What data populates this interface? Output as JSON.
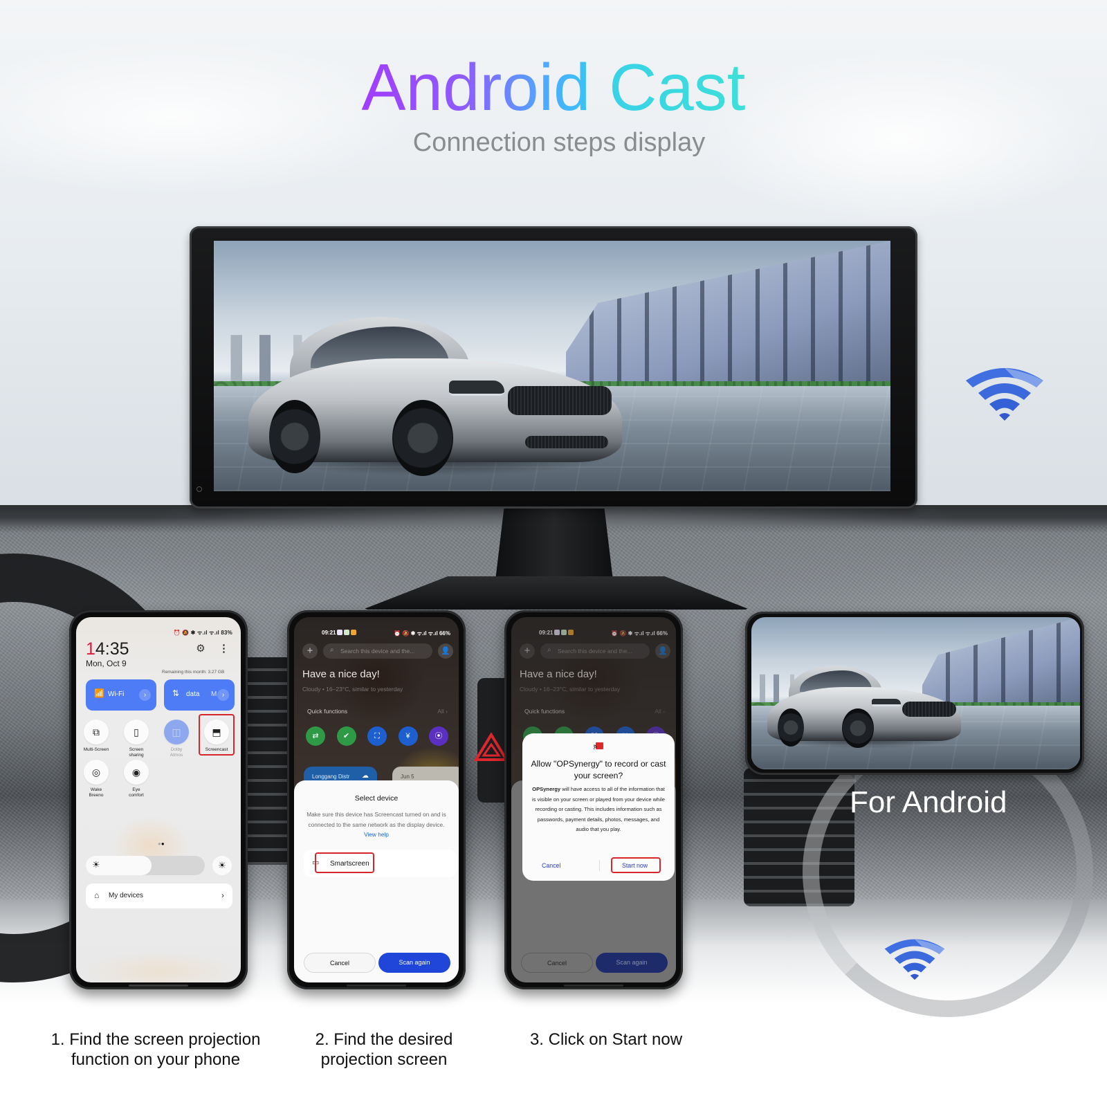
{
  "header": {
    "title_part1": "Android",
    "title_part2": "Cast",
    "subtitle": "Connection steps display"
  },
  "colors": {
    "title_gradient_start": "#a23cff",
    "title_gradient_mid": "#4fa9ff",
    "title_end": "#3edfd9",
    "tile_blue": "#4e7cf6",
    "highlight_red": "#d7262b",
    "scan_button_blue": "#1f45d9",
    "wifi_blue": "#3f6fe0"
  },
  "phone_android": {
    "label": "For Android"
  },
  "step1_phone": {
    "status_right": "⏰ 🔕 ✱ ᯤ.ıl ᯤ.ıl 83%",
    "time_first_digit": "1",
    "time_rest": "4:35",
    "date": "Mon, Oct 9",
    "remaining": "Remaining this month: 3.27 GB",
    "tiles": [
      {
        "icon": "wifi-icon",
        "label": "Wi-Fi"
      },
      {
        "icon": "data-icon",
        "label": "data",
        "extra": "M"
      }
    ],
    "quick_settings": [
      {
        "label": "Multi-Screen",
        "icon": "multi-screen-icon",
        "glyph": "⧉"
      },
      {
        "label": "Screen\nsharing",
        "icon": "screen-sharing-icon",
        "glyph": "▯"
      },
      {
        "label": "Dolby\nAtmos",
        "icon": "dolby-icon",
        "glyph": "◫"
      },
      {
        "label": "Screencast",
        "icon": "screencast-icon",
        "glyph": "⬒"
      },
      {
        "label": "Wake\nBreeno",
        "icon": "breeno-icon",
        "glyph": "◎"
      },
      {
        "label": "Eye\ncomfort",
        "icon": "eye-icon",
        "glyph": "◉"
      }
    ],
    "brightness_fraction": 0.55,
    "my_devices_label": "My devices"
  },
  "launcher": {
    "status_time": "09:21",
    "status_right": "⏰ 🔕 ✱ ᯤ.ıl ᯤ.ıl 66%",
    "search_placeholder": "Search this device and the...",
    "greeting": "Have a nice day!",
    "weather": "Cloudy • 16–23°C, similar to yesterday",
    "quick_functions_label": "Quick functions",
    "all_label": "All",
    "apps": [
      {
        "icon": "app-transfer-icon",
        "color": "#2e9a46",
        "glyph": "⇄"
      },
      {
        "icon": "app-check-icon",
        "color": "#2e9a46",
        "glyph": "✔"
      },
      {
        "icon": "app-scan-icon",
        "color": "#1e5fd0",
        "glyph": "⛶"
      },
      {
        "icon": "app-wallet-icon",
        "color": "#1e5fd0",
        "glyph": "¥"
      },
      {
        "icon": "app-camera-scan-icon",
        "color": "#5b2fc0",
        "glyph": "⦿"
      }
    ],
    "widget_location": "Longgang Distr",
    "widget_date": "Jun 5"
  },
  "step2_sheet": {
    "title": "Select device",
    "description": "Make sure this device has Screencast turned on and is connected to the same network as the display device.",
    "help_link": "View help",
    "device_name": "Smartscreen",
    "cancel_label": "Cancel",
    "scan_label": "Scan again"
  },
  "step3_dialog": {
    "title": "Allow \"OPSynergy\" to record or cast your screen?",
    "body_app": "OPSynergy",
    "body": " will have access to all of the information that is visible on your screen or played from your device while recording or casting. This includes information such as passwords, payment details, photos, messages, and audio that you play.",
    "cancel_label": "Cancel",
    "start_label": "Start now"
  },
  "captions": [
    {
      "line1": "1. Find the screen projection",
      "line2": "function on your phone"
    },
    {
      "line1": "2. Find the desired",
      "line2": "projection screen"
    },
    {
      "line1": "3. Click on Start now",
      "line2": ""
    }
  ]
}
